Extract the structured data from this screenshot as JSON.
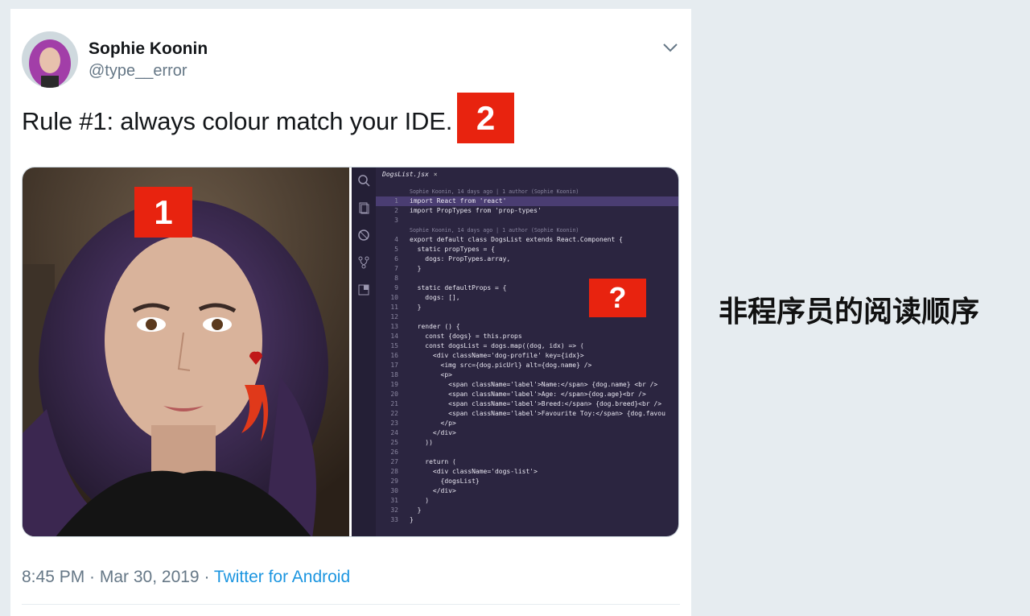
{
  "author": {
    "name": "Sophie Koonin",
    "handle": "@type__error"
  },
  "tweet": {
    "text": "Rule #1: always colour match your IDE.",
    "timestamp": "8:45 PM · Mar 30, 2019 · ",
    "source": "Twitter for Android"
  },
  "badges": {
    "photo": "1",
    "text": "2",
    "code": "?"
  },
  "ide": {
    "tab_label": "DogsList.jsx",
    "tab_close": "×",
    "lines": [
      {
        "annot": "Sophie Koonin, 14 days ago | 1 author (Sophie Koonin)"
      },
      {
        "n": "1",
        "code": "import React from 'react'",
        "hl": true
      },
      {
        "n": "2",
        "code": "import PropTypes from 'prop-types'"
      },
      {
        "n": "3",
        "code": ""
      },
      {
        "annot": "Sophie Koonin, 14 days ago | 1 author (Sophie Koonin)"
      },
      {
        "n": "4",
        "code": "export default class DogsList extends React.Component {"
      },
      {
        "n": "5",
        "code": "  static propTypes = {"
      },
      {
        "n": "6",
        "code": "    dogs: PropTypes.array,"
      },
      {
        "n": "7",
        "code": "  }"
      },
      {
        "n": "8",
        "code": ""
      },
      {
        "n": "9",
        "code": "  static defaultProps = {"
      },
      {
        "n": "10",
        "code": "    dogs: [],"
      },
      {
        "n": "11",
        "code": "  }"
      },
      {
        "n": "12",
        "code": ""
      },
      {
        "n": "13",
        "code": "  render () {"
      },
      {
        "n": "14",
        "code": "    const {dogs} = this.props"
      },
      {
        "n": "15",
        "code": "    const dogsList = dogs.map((dog, idx) => ("
      },
      {
        "n": "16",
        "code": "      <div className='dog-profile' key={idx}>"
      },
      {
        "n": "17",
        "code": "        <img src={dog.picUrl} alt={dog.name} />"
      },
      {
        "n": "18",
        "code": "        <p>"
      },
      {
        "n": "19",
        "code": "          <span className='label'>Name:</span> {dog.name} <br />"
      },
      {
        "n": "20",
        "code": "          <span className='label'>Age: </span>{dog.age}<br />"
      },
      {
        "n": "21",
        "code": "          <span className='label'>Breed:</span> {dog.breed}<br />"
      },
      {
        "n": "22",
        "code": "          <span className='label'>Favourite Toy:</span> {dog.favou"
      },
      {
        "n": "23",
        "code": "        </p>"
      },
      {
        "n": "24",
        "code": "      </div>"
      },
      {
        "n": "25",
        "code": "    ))"
      },
      {
        "n": "26",
        "code": ""
      },
      {
        "n": "27",
        "code": "    return ("
      },
      {
        "n": "28",
        "code": "      <div className='dogs-list'>"
      },
      {
        "n": "29",
        "code": "        {dogsList}"
      },
      {
        "n": "30",
        "code": "      </div>"
      },
      {
        "n": "31",
        "code": "    )"
      },
      {
        "n": "32",
        "code": "  }"
      },
      {
        "n": "33",
        "code": "}"
      }
    ]
  },
  "side_note": "非程序员的阅读顺序",
  "colors": {
    "badge_red": "#e8230f",
    "link_blue": "#1b95e0",
    "ide_bg": "#2b2540"
  }
}
